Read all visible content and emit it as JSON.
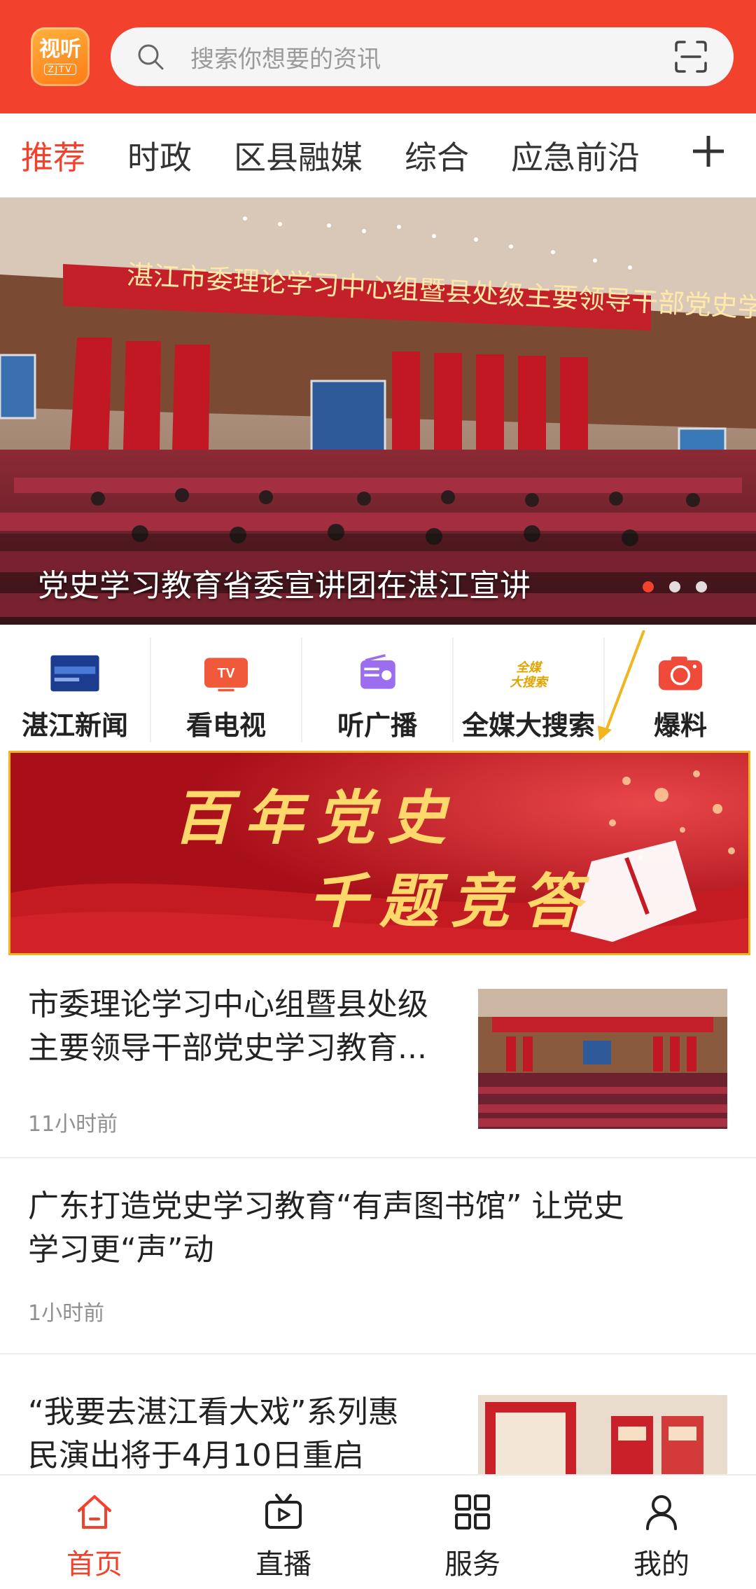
{
  "header": {
    "logo_text": "视听",
    "logo_sub": "ZJTV",
    "search_placeholder": "搜索你想要的资讯",
    "accent": "#f2412c"
  },
  "tabs": [
    {
      "label": "推荐",
      "active": true
    },
    {
      "label": "时政",
      "active": false
    },
    {
      "label": "区县融媒",
      "active": false
    },
    {
      "label": "综合",
      "active": false
    },
    {
      "label": "应急前沿",
      "active": false
    }
  ],
  "hero": {
    "caption": "党史学习教育省委宣讲团在湛江宣讲",
    "image_banner_text": "湛江市委理论学习中心组暨县处级主要领导干部党史学习教育专题研讨班",
    "slide_count": 3,
    "active_slide": 1
  },
  "quick_links": [
    {
      "label": "湛江新闻",
      "icon": "news-tv-icon"
    },
    {
      "label": "看电视",
      "icon": "tv-icon"
    },
    {
      "label": "听广播",
      "icon": "radio-icon"
    },
    {
      "label": "全媒大搜索",
      "icon": "search-logo-icon"
    },
    {
      "label": "爆料",
      "icon": "camera-icon"
    }
  ],
  "banner": {
    "line1": "百年党史",
    "line2": "千题竞答"
  },
  "news": [
    {
      "title_line1": "市委理论学习中心组暨县处级",
      "title_line2": "主要领导干部党史学习教育...",
      "time": "11小时前",
      "has_thumb": true
    },
    {
      "title_line1": "广东打造党史学习教育“有声图书馆” 让党史",
      "title_line2": "学习更“声”动",
      "time": "1小时前",
      "has_thumb": false
    },
    {
      "title_line1": "“我要去湛江看大戏”系列惠",
      "title_line2": "民演出将于4月10日重启",
      "has_thumb": true
    }
  ],
  "bottom_nav": [
    {
      "label": "首页",
      "icon": "home-icon",
      "active": true
    },
    {
      "label": "直播",
      "icon": "live-icon",
      "active": false
    },
    {
      "label": "服务",
      "icon": "grid-icon",
      "active": false
    },
    {
      "label": "我的",
      "icon": "user-icon",
      "active": false
    }
  ]
}
